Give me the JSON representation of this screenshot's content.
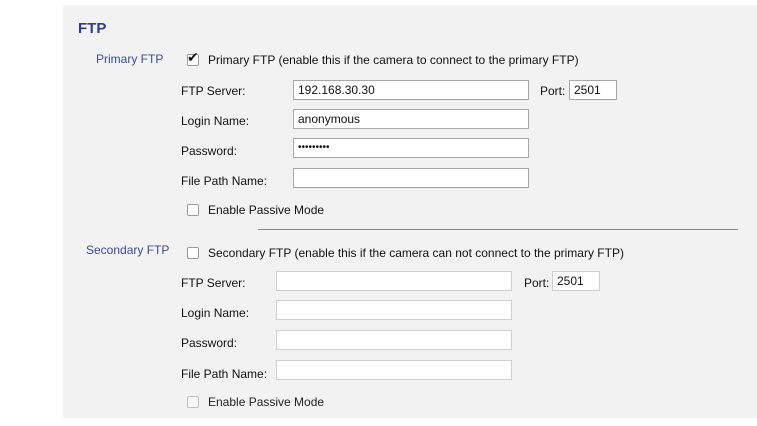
{
  "section_title": "FTP",
  "primary": {
    "label": "Primary FTP",
    "checkbox_label": "Primary FTP (enable this if the camera to connect to the primary FTP)",
    "checked": true,
    "ftp_server_label": "FTP Server:",
    "ftp_server_value": "192.168.30.30",
    "port_label": "Port:",
    "port_value": "2501",
    "login_label": "Login Name:",
    "login_value": "anonymous",
    "password_label": "Password:",
    "password_value": "•••••••••",
    "filepath_label": "File Path Name:",
    "filepath_value": "",
    "passive_label": "Enable Passive Mode",
    "passive_checked": false
  },
  "secondary": {
    "label": "Secondary FTP",
    "checkbox_label": "Secondary FTP (enable this if the camera can not connect to the primary FTP)",
    "checked": false,
    "ftp_server_label": "FTP Server:",
    "ftp_server_value": "",
    "port_label": "Port:",
    "port_value": "2501",
    "login_label": "Login Name:",
    "login_value": "",
    "password_label": "Password:",
    "password_value": "",
    "filepath_label": "File Path Name:",
    "filepath_value": "",
    "passive_label": "Enable Passive Mode",
    "passive_checked": false
  },
  "icons": {
    "checkmark": "checkmark-icon"
  }
}
